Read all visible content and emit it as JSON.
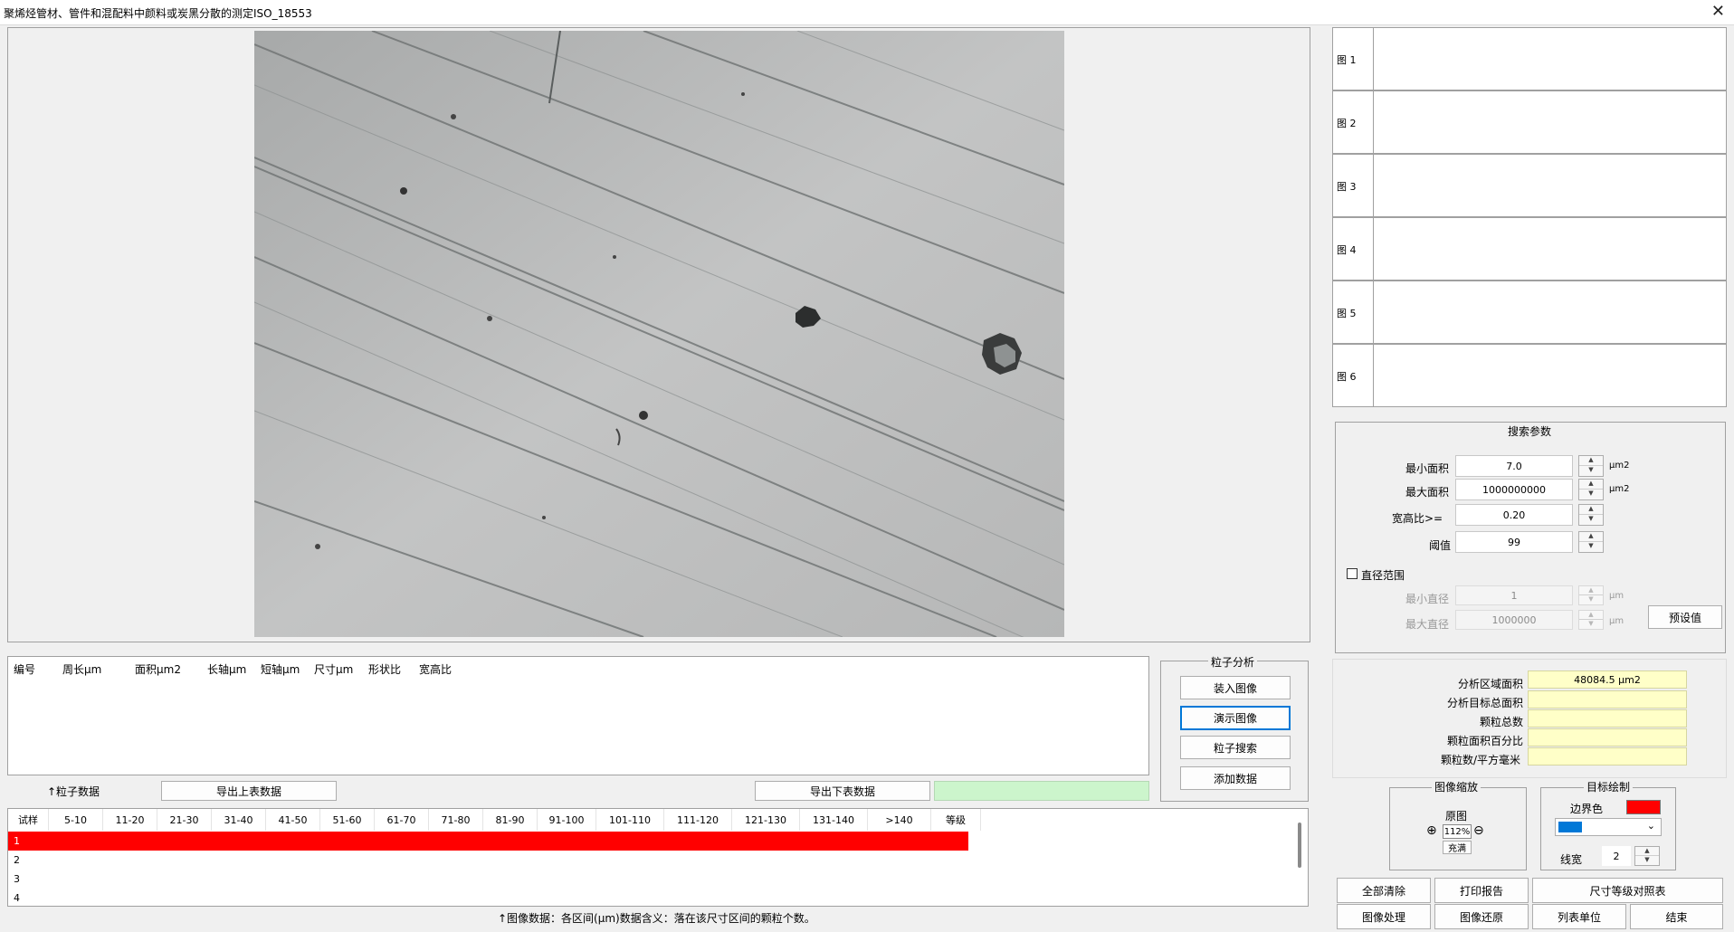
{
  "window": {
    "title": "聚烯烃管材、管件和混配料中颜料或炭黑分散的测定ISO_18553",
    "close_glyph": "✕"
  },
  "thumbnails": [
    {
      "label": "图 1"
    },
    {
      "label": "图 2"
    },
    {
      "label": "图 3"
    },
    {
      "label": "图 4"
    },
    {
      "label": "图 5"
    },
    {
      "label": "图 6"
    }
  ],
  "particle_table": {
    "headers": [
      "编号",
      "周长μm",
      "面积μm2",
      "长轴μm",
      "短轴μm",
      "尺寸μm",
      "形状比",
      "宽高比"
    ]
  },
  "particle_analysis": {
    "title": "粒子分析",
    "load_image": "装入图像",
    "demo_image": "演示图像",
    "particle_search": "粒子搜索",
    "add_data": "添加数据"
  },
  "data_bar": {
    "particle_data_label": "↑粒子数据",
    "export_upper": "导出上表数据",
    "export_lower": "导出下表数据"
  },
  "grade_table": {
    "headers": [
      "试样",
      "5-10",
      "11-20",
      "21-30",
      "31-40",
      "41-50",
      "51-60",
      "61-70",
      "71-80",
      "81-90",
      "91-100",
      "101-110",
      "111-120",
      "121-130",
      "131-140",
      ">140",
      "等级"
    ],
    "rows": [
      "1",
      "2",
      "3",
      "4"
    ],
    "highlight_color": "#ff0000"
  },
  "footer_note": "↑图像数据：各区间(μm)数据含义：落在该尺寸区间的颗粒个数。",
  "search_params": {
    "title": "搜索参数",
    "min_area": {
      "label": "最小面积",
      "value": "7.0",
      "unit": "μm2"
    },
    "max_area": {
      "label": "最大面积",
      "value": "1000000000",
      "unit": "μm2"
    },
    "aspect": {
      "label": "宽高比>=",
      "value": "0.20"
    },
    "threshold": {
      "label": "阈值",
      "value": "99"
    },
    "diameter_range": "直径范围",
    "min_diameter": {
      "label": "最小直径",
      "value": "1",
      "unit": "μm"
    },
    "max_diameter": {
      "label": "最大直径",
      "value": "1000000",
      "unit": "μm"
    },
    "preset": "预设值"
  },
  "results": {
    "analysis_area": {
      "label": "分析区域面积",
      "value": "48084.5 μm2"
    },
    "target_area": {
      "label": "分析目标总面积",
      "value": ""
    },
    "particle_count": {
      "label": "颗粒总数",
      "value": ""
    },
    "area_percent": {
      "label": "颗粒面积百分比",
      "value": ""
    },
    "per_mm2": {
      "label": "颗粒数/平方毫米",
      "value": ""
    }
  },
  "zoom": {
    "title": "图像缩放",
    "original": "原图",
    "level": "112%",
    "fill": "充满"
  },
  "target_draw": {
    "title": "目标绘制",
    "border_color_label": "边界色",
    "border_color": "#ff0000",
    "line_color": "#0078d7",
    "line_width_label": "线宽",
    "line_width": "2"
  },
  "bottom_buttons": {
    "clear_all": "全部清除",
    "print_report": "打印报告",
    "size_grade_table": "尺寸等级对照表",
    "image_process": "图像处理",
    "image_restore": "图像还原",
    "list_unit": "列表单位",
    "end": "结束"
  }
}
